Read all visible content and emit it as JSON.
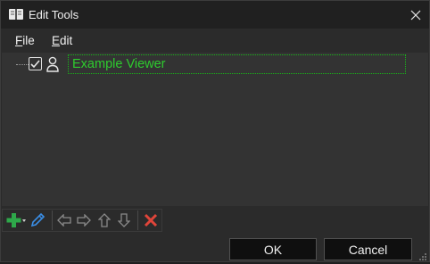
{
  "window": {
    "title": "Edit Tools"
  },
  "menu": {
    "items": [
      {
        "mnemonic": "F",
        "rest": "ile"
      },
      {
        "mnemonic": "E",
        "rest": "dit"
      }
    ]
  },
  "tree": {
    "item": {
      "label": "Example Viewer",
      "checked": true
    }
  },
  "toolbar": {
    "buttons": [
      "add-icon",
      "edit-icon",
      "move-left-icon",
      "move-right-icon",
      "move-up-icon",
      "move-down-icon",
      "delete-icon"
    ]
  },
  "dialog": {
    "ok_label": "OK",
    "cancel_label": "Cancel"
  },
  "colors": {
    "accent_green": "#2ecc2e",
    "delete_red": "#e0453a",
    "edit_blue": "#3a8ee6"
  }
}
